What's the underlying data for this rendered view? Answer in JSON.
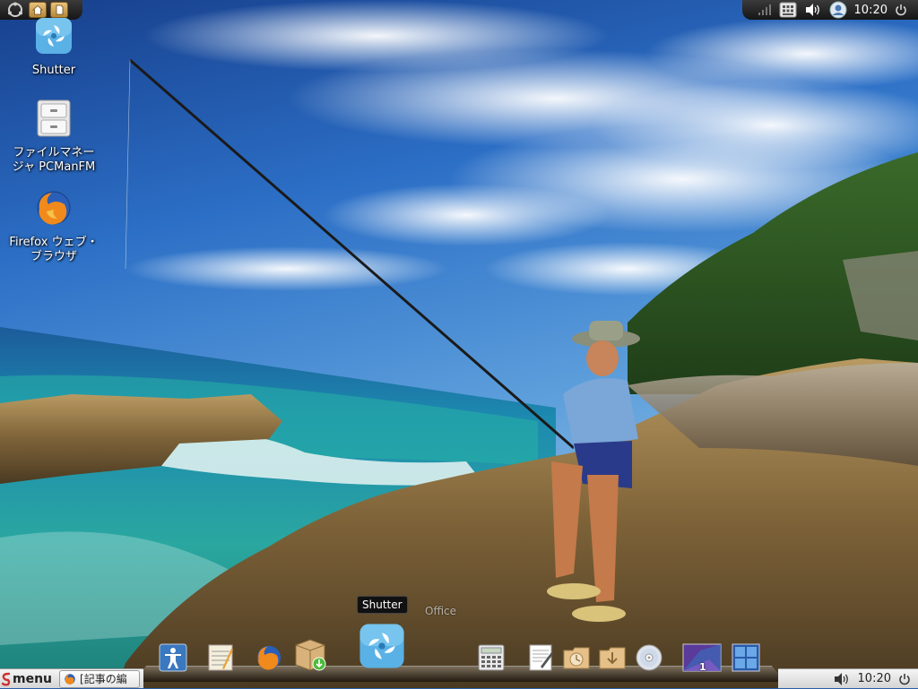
{
  "desktop": {
    "icons": [
      {
        "label": "Shutter"
      },
      {
        "label_line1": "ファイルマネー",
        "label_line2": "ジャ PCManFM"
      },
      {
        "label_line1": "Firefox ウェブ・",
        "label_line2": "ブラウザ"
      }
    ]
  },
  "top_panel": {
    "clock": "10:20",
    "icons": [
      "ubuntu-logo-icon",
      "home-folder-icon",
      "documents-folder-icon",
      "network-signal-icon",
      "keyboard-icon",
      "volume-icon",
      "user-icon",
      "power-icon"
    ]
  },
  "dock": {
    "tooltip": "Shutter",
    "ghost_label": "Office",
    "workspace_badge": "1",
    "items": [
      "accessibility",
      "text-editor",
      "firefox",
      "package-installer",
      "shutter",
      "calculator",
      "writer",
      "clock-folder",
      "downloads-folder",
      "cd-disc",
      "workspace-switcher",
      "window-tile"
    ]
  },
  "bottom_panel": {
    "menu_label": "menu",
    "task_label": "[記事の編",
    "clock": "10:20"
  },
  "colors": {
    "panel_dark": "#1c1c1c",
    "panel_light": "#e6e6e6",
    "sky_blue": "#2a5fa8",
    "sea_teal": "#2aa7a0"
  }
}
